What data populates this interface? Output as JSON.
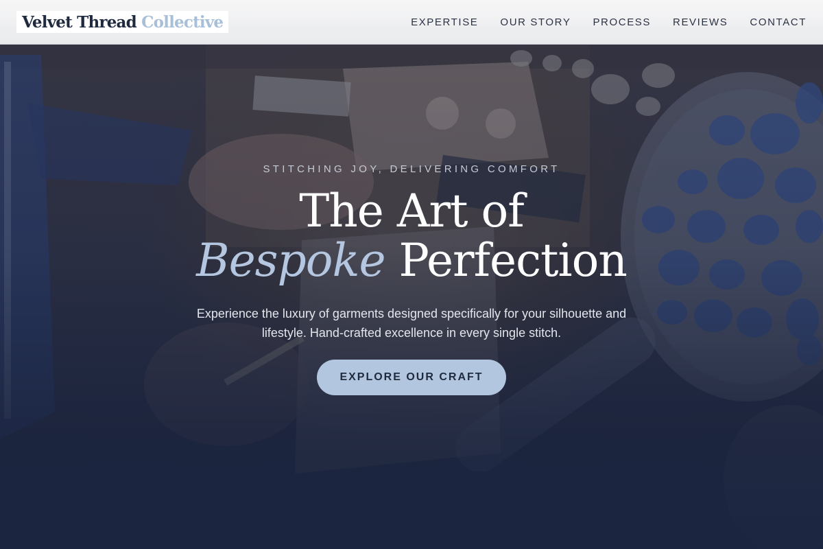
{
  "header": {
    "logo": {
      "main": "Velvet Thread",
      "accent": "Collective"
    },
    "nav": [
      {
        "label": "EXPERTISE"
      },
      {
        "label": "OUR STORY"
      },
      {
        "label": "PROCESS"
      },
      {
        "label": "REVIEWS"
      },
      {
        "label": "CONTACT"
      }
    ]
  },
  "hero": {
    "eyebrow": "STITCHING JOY, DELIVERING COMFORT",
    "headline_line1": "The Art of",
    "headline_accent": "Bespoke",
    "headline_rest": " Perfection",
    "subtitle": "Experience the luxury of garments designed specifically for your silhouette and lifestyle. Hand-crafted excellence in every single stitch.",
    "cta_label": "EXPLORE OUR CRAFT"
  },
  "colors": {
    "header_bg": "#f2f2f4",
    "logo_accent": "#a8bfd9",
    "headline_accent": "#b4c6e0",
    "cta_bg": "#b3c6df",
    "overlay": "#1b2540"
  }
}
